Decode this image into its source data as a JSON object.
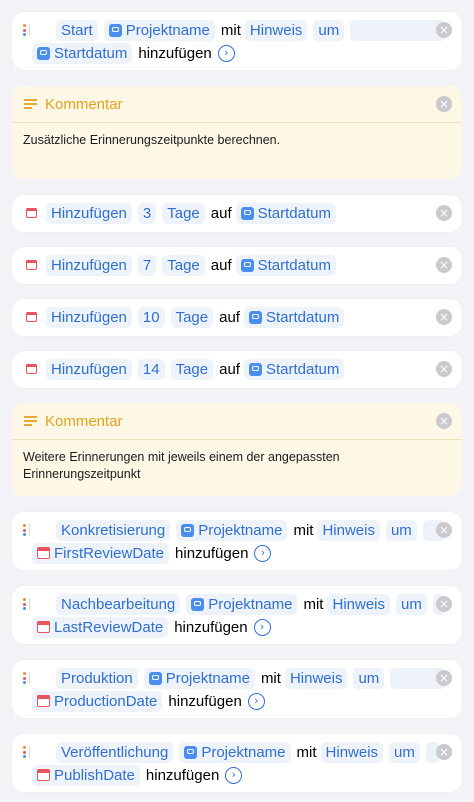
{
  "blocks": {
    "start_reminder": {
      "text": "Start",
      "var": "Projektname",
      "mit": "mit",
      "hinweis": "Hinweis",
      "um": "um",
      "date_var": "Startdatum",
      "hinzufuegen": "hinzufügen"
    },
    "comment1": {
      "title": "Kommentar",
      "body": "Zusätzliche Erinnerungszeitpunkte berechnen."
    },
    "add_dates": [
      {
        "action": "Hinzufügen",
        "amount": "3",
        "unit": "Tage",
        "auf": "auf",
        "var": "Startdatum"
      },
      {
        "action": "Hinzufügen",
        "amount": "7",
        "unit": "Tage",
        "auf": "auf",
        "var": "Startdatum"
      },
      {
        "action": "Hinzufügen",
        "amount": "10",
        "unit": "Tage",
        "auf": "auf",
        "var": "Startdatum"
      },
      {
        "action": "Hinzufügen",
        "amount": "14",
        "unit": "Tage",
        "auf": "auf",
        "var": "Startdatum"
      }
    ],
    "comment2": {
      "title": "Kommentar",
      "body": "Weitere Erinnerungen mit jeweils einem der angepassten Erinnerungszeitpunkt"
    },
    "reminders": [
      {
        "text": "Konkretisierung",
        "var": "Projektname",
        "mit": "mit",
        "hinweis": "Hinweis",
        "um": "um",
        "date_var": "FirstReviewDate",
        "hinzufuegen": "hinzufügen"
      },
      {
        "text": "Nachbearbeitung",
        "var": "Projektname",
        "mit": "mit",
        "hinweis": "Hinweis",
        "um": "um",
        "date_var": "LastReviewDate",
        "hinzufuegen": "hinzufügen"
      },
      {
        "text": "Produktion",
        "var": "Projektname",
        "mit": "mit",
        "hinweis": "Hinweis",
        "um": "um",
        "date_var": "ProductionDate",
        "hinzufuegen": "hinzufügen"
      },
      {
        "text": "Veröffentlichung",
        "var": "Projektname",
        "mit": "mit",
        "hinweis": "Hinweis",
        "um": "um",
        "date_var": "PublishDate",
        "hinzufuegen": "hinzufügen"
      }
    ]
  },
  "icons": {
    "close": "×",
    "chevron": "›"
  },
  "colors": {
    "accent": "#2f6fd1",
    "comment": "#e3a21b",
    "comment_bg": "#fdf7e6",
    "calendar": "#e7545d"
  }
}
